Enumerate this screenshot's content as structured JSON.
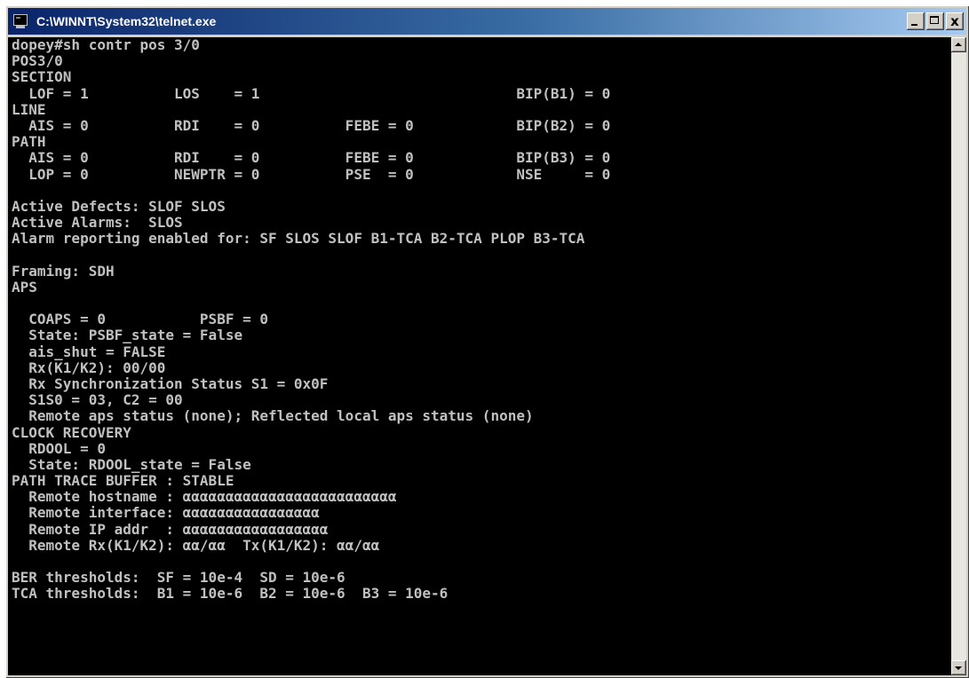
{
  "window": {
    "title": "C:\\WINNT\\System32\\telnet.exe",
    "icon": "console-window-icon",
    "controls": [
      "minimize-icon",
      "maximize-icon",
      "close-icon"
    ],
    "close_glyph": "x"
  },
  "console": {
    "background": "#000000",
    "foreground": "#c0c0c0",
    "lines": [
      "dopey#sh contr pos 3/0",
      "POS3/0",
      "SECTION",
      "  LOF = 1          LOS    = 1                              BIP(B1) = 0",
      "LINE",
      "  AIS = 0          RDI    = 0          FEBE = 0            BIP(B2) = 0",
      "PATH",
      "  AIS = 0          RDI    = 0          FEBE = 0            BIP(B3) = 0",
      "  LOP = 0          NEWPTR = 0          PSE  = 0            NSE     = 0",
      "",
      "Active Defects: SLOF SLOS",
      "Active Alarms:  SLOS",
      "Alarm reporting enabled for: SF SLOS SLOF B1-TCA B2-TCA PLOP B3-TCA",
      "",
      "Framing: SDH",
      "APS",
      "",
      "  COAPS = 0           PSBF = 0",
      "  State: PSBF_state = False",
      "  ais_shut = FALSE",
      "  Rx(K1/K2): 00/00",
      "  Rx Synchronization Status S1 = 0x0F",
      "  S1S0 = 03, C2 = 00",
      "  Remote aps status (none); Reflected local aps status (none)",
      "CLOCK RECOVERY",
      "  RDOOL = 0",
      "  State: RDOOL_state = False",
      "PATH TRACE BUFFER : STABLE",
      "  Remote hostname : ααααααααααααααααααααααααα",
      "  Remote interface: αααααααααααααααα",
      "  Remote IP addr  : ααααααααααααααααα",
      "  Remote Rx(K1/K2): αα/αα  Tx(K1/K2): αα/αα",
      "",
      "BER thresholds:  SF = 10e-4  SD = 10e-6",
      "TCA thresholds:  B1 = 10e-6  B2 = 10e-6  B3 = 10e-6"
    ]
  }
}
